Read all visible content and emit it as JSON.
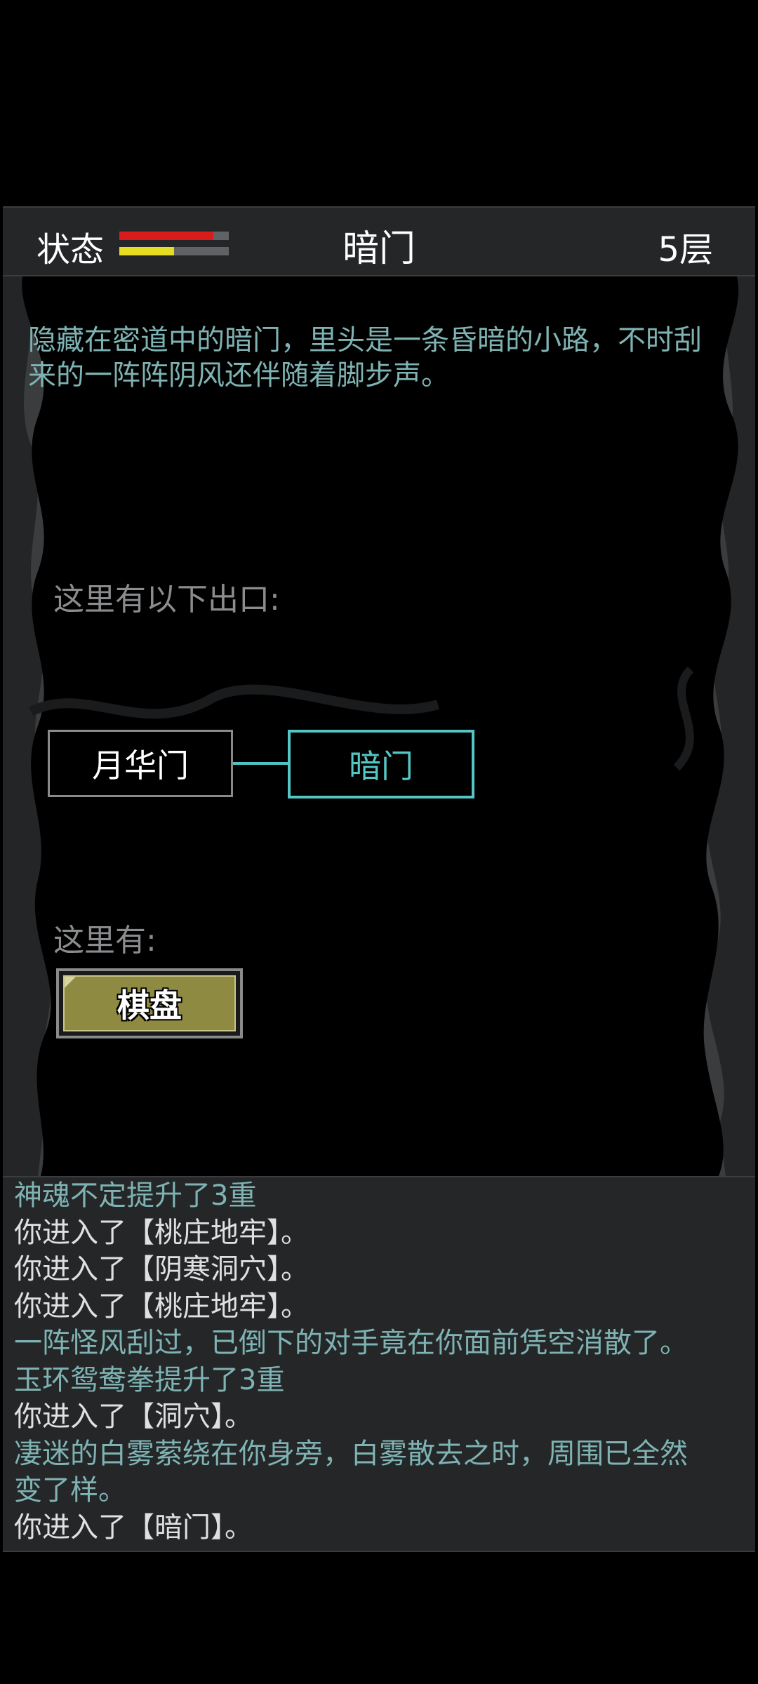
{
  "header": {
    "status_label": "状态",
    "hp_fraction": 0.86,
    "mp_fraction": 0.5,
    "location_title": "暗门",
    "floor_label": "5层"
  },
  "scene": {
    "description": "隐藏在密道中的暗门，里头是一条昏暗的小路，不时刮来的一阵阵阴风还伴随着脚步声。",
    "exits_label": "这里有以下出口:",
    "room_current": "月华门",
    "room_target": "暗门",
    "here_label": "这里有:",
    "items": [
      "棋盘"
    ]
  },
  "log": {
    "lines": [
      {
        "text": "神魂不定提升了3重",
        "style": "teal"
      },
      {
        "text": "你进入了【桃庄地牢】。",
        "style": "white"
      },
      {
        "text": "你进入了【阴寒洞穴】。",
        "style": "white"
      },
      {
        "text": "你进入了【桃庄地牢】。",
        "style": "white"
      },
      {
        "text": "一阵怪风刮过，已倒下的对手竟在你面前凭空消散了。",
        "style": "teal"
      },
      {
        "text": "玉环鸳鸯拳提升了3重",
        "style": "teal"
      },
      {
        "text": "你进入了【洞穴】。",
        "style": "white"
      },
      {
        "text": "凄迷的白雾萦绕在你身旁，白雾散去之时，周围已全然",
        "style": "teal"
      },
      {
        "text": "变了样。",
        "style": "teal"
      },
      {
        "text": "你进入了【暗门】。",
        "style": "white"
      }
    ]
  },
  "colors": {
    "panel": "#242628",
    "teal_text": "#7fb3b3",
    "accent_cyan": "#55c6c6",
    "hp": "#d81c1c",
    "mp": "#e6dc22",
    "item_bg": "#8e8a42"
  }
}
